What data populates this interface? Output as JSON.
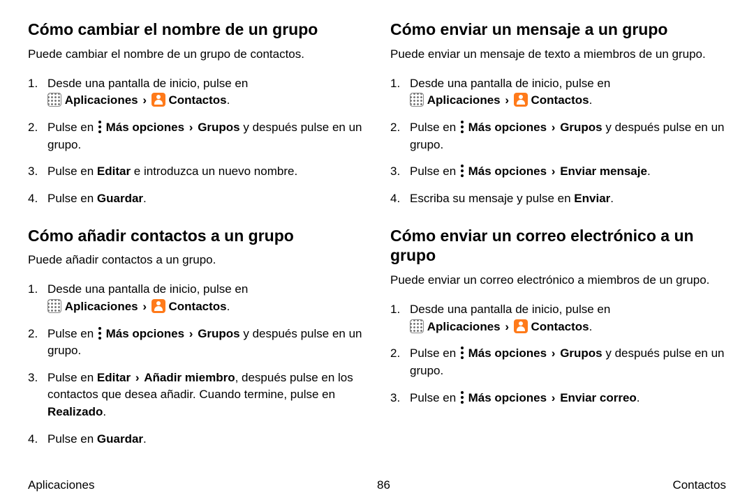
{
  "glyphs": {
    "chevron": "›"
  },
  "left": {
    "s1": {
      "heading": "Cómo cambiar el nombre de un grupo",
      "intro": "Puede cambiar el nombre de un grupo de contactos.",
      "st1a": "Desde una pantalla de inicio, pulse en ",
      "apps": "Aplicaciones",
      "contacts": "Contactos",
      "dot": ".",
      "st2a": "Pulse en ",
      "more": "Más opciones",
      "groups": "Grupos",
      "st2b": " y después pulse en un grupo.",
      "st3a": "Pulse en ",
      "edit": "Editar",
      "st3b": " e introduzca un nuevo nombre.",
      "st4a": "Pulse en ",
      "save": "Guardar"
    },
    "s2": {
      "heading": "Cómo añadir contactos a un grupo",
      "intro": "Puede añadir contactos a un grupo.",
      "st1a": "Desde una pantalla de inicio, pulse en ",
      "apps": "Aplicaciones",
      "contacts": "Contactos",
      "dot": ".",
      "st2a": "Pulse en ",
      "more": "Más opciones",
      "groups": "Grupos",
      "st2b": " y después pulse en un grupo.",
      "st3a": "Pulse en ",
      "edit": "Editar",
      "addmember": "Añadir miembro",
      "st3b": ", después pulse en los contactos que desea añadir. Cuando termine, pulse en ",
      "done": "Realizado",
      "st4a": "Pulse en ",
      "save": "Guardar"
    }
  },
  "right": {
    "s1": {
      "heading": "Cómo enviar un mensaje a un grupo",
      "intro": "Puede enviar un mensaje de texto a miembros de un grupo.",
      "st1a": "Desde una pantalla de inicio, pulse en ",
      "apps": "Aplicaciones",
      "contacts": "Contactos",
      "dot": ".",
      "st2a": "Pulse en ",
      "more": "Más opciones",
      "groups": "Grupos",
      "st2b": " y después pulse en un grupo.",
      "st3a": "Pulse en ",
      "sendmsg": "Enviar mensaje",
      "st4a": "Escriba su mensaje y pulse en ",
      "send": "Enviar"
    },
    "s2": {
      "heading": "Cómo enviar un correo electrónico a un grupo",
      "intro": "Puede enviar un correo electrónico a miembros de un grupo.",
      "st1a": "Desde una pantalla de inicio, pulse en ",
      "apps": "Aplicaciones",
      "contacts": "Contactos",
      "dot": ".",
      "st2a": "Pulse en ",
      "more": "Más opciones",
      "groups": "Grupos",
      "st2b": " y después pulse en un grupo.",
      "st3a": "Pulse en ",
      "sendmail": "Enviar correo"
    }
  },
  "footer": {
    "left": "Aplicaciones",
    "page": "86",
    "right": "Contactos"
  }
}
